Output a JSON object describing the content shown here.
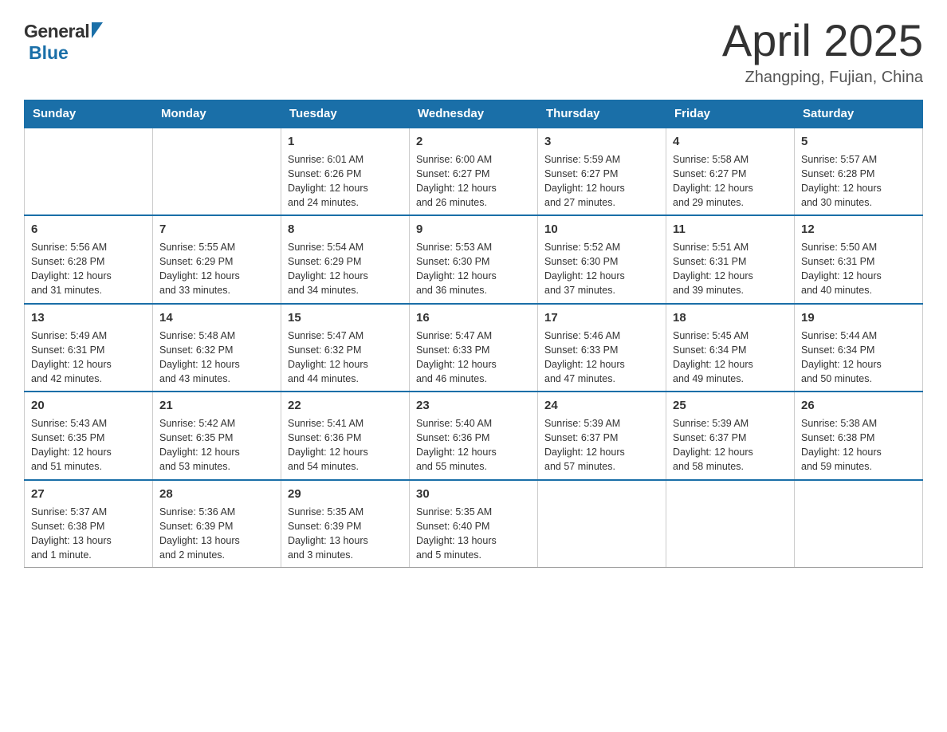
{
  "header": {
    "logo_general": "General",
    "logo_blue": "Blue",
    "month_title": "April 2025",
    "location": "Zhangping, Fujian, China"
  },
  "days_of_week": [
    "Sunday",
    "Monday",
    "Tuesday",
    "Wednesday",
    "Thursday",
    "Friday",
    "Saturday"
  ],
  "weeks": [
    [
      {
        "day": "",
        "info": ""
      },
      {
        "day": "",
        "info": ""
      },
      {
        "day": "1",
        "info": "Sunrise: 6:01 AM\nSunset: 6:26 PM\nDaylight: 12 hours\nand 24 minutes."
      },
      {
        "day": "2",
        "info": "Sunrise: 6:00 AM\nSunset: 6:27 PM\nDaylight: 12 hours\nand 26 minutes."
      },
      {
        "day": "3",
        "info": "Sunrise: 5:59 AM\nSunset: 6:27 PM\nDaylight: 12 hours\nand 27 minutes."
      },
      {
        "day": "4",
        "info": "Sunrise: 5:58 AM\nSunset: 6:27 PM\nDaylight: 12 hours\nand 29 minutes."
      },
      {
        "day": "5",
        "info": "Sunrise: 5:57 AM\nSunset: 6:28 PM\nDaylight: 12 hours\nand 30 minutes."
      }
    ],
    [
      {
        "day": "6",
        "info": "Sunrise: 5:56 AM\nSunset: 6:28 PM\nDaylight: 12 hours\nand 31 minutes."
      },
      {
        "day": "7",
        "info": "Sunrise: 5:55 AM\nSunset: 6:29 PM\nDaylight: 12 hours\nand 33 minutes."
      },
      {
        "day": "8",
        "info": "Sunrise: 5:54 AM\nSunset: 6:29 PM\nDaylight: 12 hours\nand 34 minutes."
      },
      {
        "day": "9",
        "info": "Sunrise: 5:53 AM\nSunset: 6:30 PM\nDaylight: 12 hours\nand 36 minutes."
      },
      {
        "day": "10",
        "info": "Sunrise: 5:52 AM\nSunset: 6:30 PM\nDaylight: 12 hours\nand 37 minutes."
      },
      {
        "day": "11",
        "info": "Sunrise: 5:51 AM\nSunset: 6:31 PM\nDaylight: 12 hours\nand 39 minutes."
      },
      {
        "day": "12",
        "info": "Sunrise: 5:50 AM\nSunset: 6:31 PM\nDaylight: 12 hours\nand 40 minutes."
      }
    ],
    [
      {
        "day": "13",
        "info": "Sunrise: 5:49 AM\nSunset: 6:31 PM\nDaylight: 12 hours\nand 42 minutes."
      },
      {
        "day": "14",
        "info": "Sunrise: 5:48 AM\nSunset: 6:32 PM\nDaylight: 12 hours\nand 43 minutes."
      },
      {
        "day": "15",
        "info": "Sunrise: 5:47 AM\nSunset: 6:32 PM\nDaylight: 12 hours\nand 44 minutes."
      },
      {
        "day": "16",
        "info": "Sunrise: 5:47 AM\nSunset: 6:33 PM\nDaylight: 12 hours\nand 46 minutes."
      },
      {
        "day": "17",
        "info": "Sunrise: 5:46 AM\nSunset: 6:33 PM\nDaylight: 12 hours\nand 47 minutes."
      },
      {
        "day": "18",
        "info": "Sunrise: 5:45 AM\nSunset: 6:34 PM\nDaylight: 12 hours\nand 49 minutes."
      },
      {
        "day": "19",
        "info": "Sunrise: 5:44 AM\nSunset: 6:34 PM\nDaylight: 12 hours\nand 50 minutes."
      }
    ],
    [
      {
        "day": "20",
        "info": "Sunrise: 5:43 AM\nSunset: 6:35 PM\nDaylight: 12 hours\nand 51 minutes."
      },
      {
        "day": "21",
        "info": "Sunrise: 5:42 AM\nSunset: 6:35 PM\nDaylight: 12 hours\nand 53 minutes."
      },
      {
        "day": "22",
        "info": "Sunrise: 5:41 AM\nSunset: 6:36 PM\nDaylight: 12 hours\nand 54 minutes."
      },
      {
        "day": "23",
        "info": "Sunrise: 5:40 AM\nSunset: 6:36 PM\nDaylight: 12 hours\nand 55 minutes."
      },
      {
        "day": "24",
        "info": "Sunrise: 5:39 AM\nSunset: 6:37 PM\nDaylight: 12 hours\nand 57 minutes."
      },
      {
        "day": "25",
        "info": "Sunrise: 5:39 AM\nSunset: 6:37 PM\nDaylight: 12 hours\nand 58 minutes."
      },
      {
        "day": "26",
        "info": "Sunrise: 5:38 AM\nSunset: 6:38 PM\nDaylight: 12 hours\nand 59 minutes."
      }
    ],
    [
      {
        "day": "27",
        "info": "Sunrise: 5:37 AM\nSunset: 6:38 PM\nDaylight: 13 hours\nand 1 minute."
      },
      {
        "day": "28",
        "info": "Sunrise: 5:36 AM\nSunset: 6:39 PM\nDaylight: 13 hours\nand 2 minutes."
      },
      {
        "day": "29",
        "info": "Sunrise: 5:35 AM\nSunset: 6:39 PM\nDaylight: 13 hours\nand 3 minutes."
      },
      {
        "day": "30",
        "info": "Sunrise: 5:35 AM\nSunset: 6:40 PM\nDaylight: 13 hours\nand 5 minutes."
      },
      {
        "day": "",
        "info": ""
      },
      {
        "day": "",
        "info": ""
      },
      {
        "day": "",
        "info": ""
      }
    ]
  ]
}
